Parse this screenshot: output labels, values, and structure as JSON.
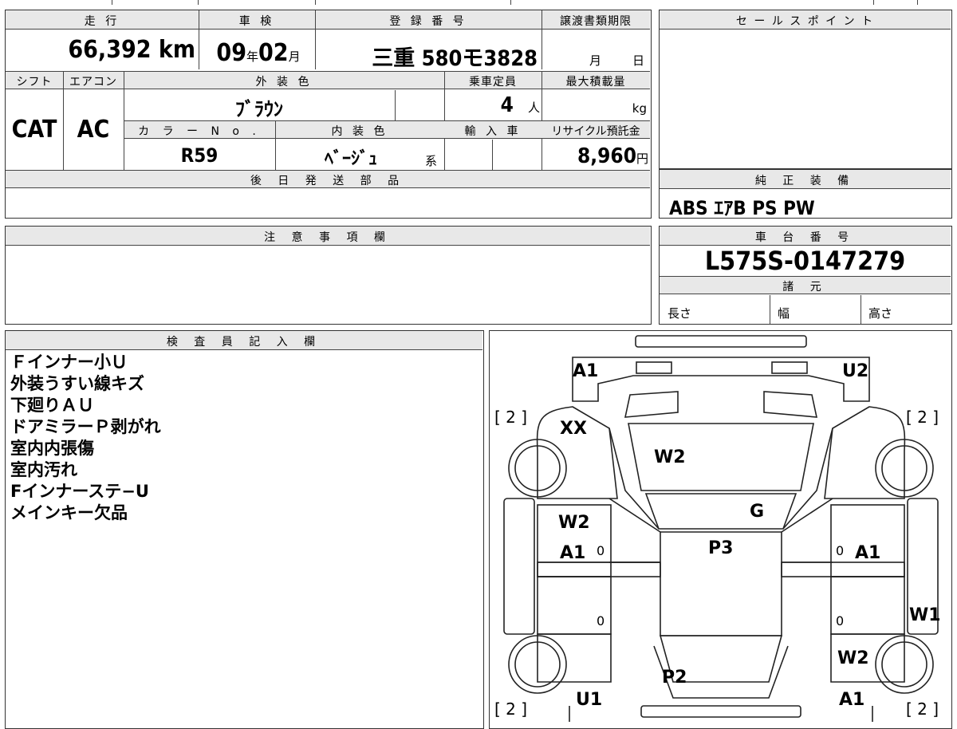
{
  "headers": {
    "mileage": "走 行",
    "inspection": "車 検",
    "registration": "登 録 番 号",
    "transfer_deadline": "譲渡書類期限",
    "sales_point": "セ ー ル ス ポ イ ン ト",
    "shift": "シフト",
    "aircon": "エアコン",
    "exterior_color": "外 装 色",
    "capacity": "乗車定員",
    "max_load": "最大積載量",
    "color_no": "カ ラ ー N o .",
    "interior_color": "内 装 色",
    "import": "輸 入 車",
    "recycle": "リサイクル預託金",
    "later_parts": "後 日 発 送 部 品",
    "genuine_equipment": "純 正 装 備",
    "caution": "注 意 事 項 欄",
    "chassis_number": "車 台 番 号",
    "specs": "諸 元",
    "inspector_notes": "検 査 員 記 入 欄"
  },
  "values": {
    "mileage": "66,392",
    "mileage_unit": "km",
    "inspection_year": "09",
    "year_unit": "年",
    "inspection_month": "02",
    "month_unit": "月",
    "registration": "三重 580モ3828",
    "deadline_month": "月",
    "deadline_day": "日",
    "shift": "CAT",
    "aircon": "AC",
    "exterior_color": "ﾌﾞﾗｳﾝ",
    "capacity": "4",
    "capacity_unit": "人",
    "max_load_unit": "kg",
    "color_no": "R59",
    "interior_color": "ﾍﾞｰｼﾞｭ",
    "interior_suffix": "系",
    "recycle": "8,960",
    "recycle_unit": "円",
    "genuine_equipment": "ABS ｴｱB PS PW",
    "chassis_number": "L575S-0147279",
    "spec_length": "長さ",
    "spec_width": "幅",
    "spec_height": "高さ"
  },
  "inspector_notes": [
    "Ｆインナー小Ｕ",
    "外装うすい線キズ",
    "下廻りＡＵ",
    "ドアミラーＰ剥がれ",
    "室内内張傷",
    "室内汚れ",
    "Fインナーステ−U",
    "メインキー欠品"
  ],
  "diagram": {
    "marks": {
      "front_left": "A1",
      "front_right": "U2",
      "hood_left": "XX",
      "hood": "W2",
      "windshield": "G",
      "left_front_door": "W2",
      "left_front_door_2": "A1",
      "roof": "P3",
      "right_front_door": "A1",
      "right_rear_fender": "W1",
      "right_rear": "W2",
      "tailgate": "P2",
      "rear_left": "U1",
      "rear_right": "A1",
      "zero": "0"
    },
    "bracket_labels": {
      "tl": "[ 2 ]",
      "tr": "[ 2 ]",
      "bl": "[ 2 ]",
      "br": "[ 2 ]"
    }
  }
}
